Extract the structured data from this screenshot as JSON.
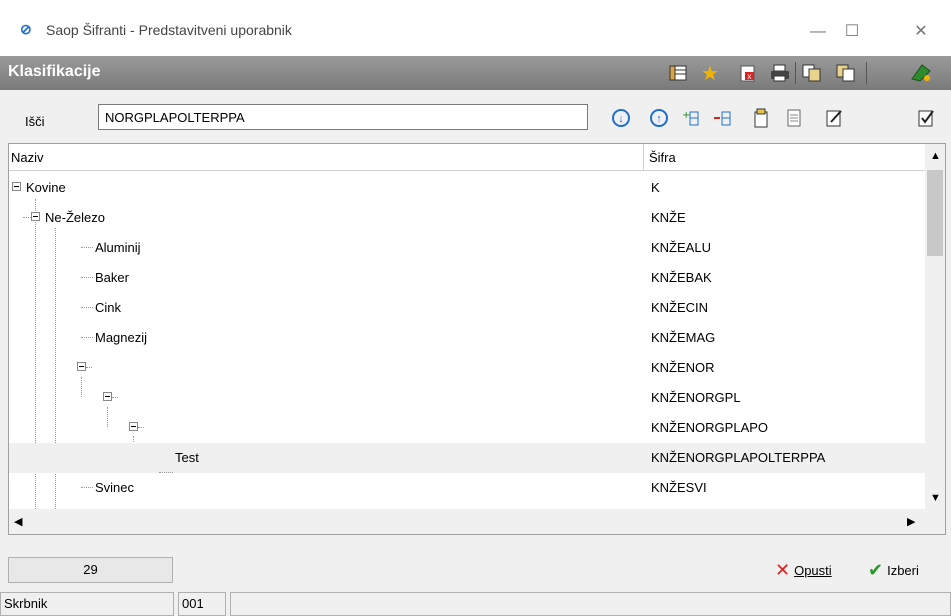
{
  "window": {
    "title": "Saop Šifranti - Predstavitveni uporabnik",
    "minimize_glyph": "—",
    "maximize_glyph": "☐",
    "close_glyph": "✕"
  },
  "header": {
    "title": "Klasifikacije",
    "toolbar_icons": [
      "columns-icon",
      "star-icon",
      "delete-icon",
      "print-icon",
      "copy-icon",
      "paste-icon",
      "exit-icon"
    ]
  },
  "search": {
    "label": "Išči",
    "value": "NORGPLAPOLTERPPA",
    "actions": [
      "arrow-down-icon",
      "arrow-up-icon",
      "add-child-icon",
      "remove-icon",
      "new-icon",
      "document-icon",
      "edit-icon",
      "edit-check-icon"
    ]
  },
  "tree": {
    "columns": {
      "name": "Naziv",
      "code": "Šifra"
    },
    "rows": [
      {
        "name": "Kovine",
        "code": "K"
      },
      {
        "name": "Ne-Železo",
        "code": "KNŽE"
      },
      {
        "name": "Aluminij",
        "code": "KNŽEALU"
      },
      {
        "name": "Baker",
        "code": "KNŽEBAK"
      },
      {
        "name": "Cink",
        "code": "KNŽECIN"
      },
      {
        "name": "Magnezij",
        "code": "KNŽEMAG"
      },
      {
        "name": "",
        "code": "KNŽENOR"
      },
      {
        "name": "",
        "code": "KNŽENORGPL"
      },
      {
        "name": "",
        "code": "KNŽENORGPLAPO"
      },
      {
        "name": "Test",
        "code": "KNŽENORGPLAPOLTERPPA"
      },
      {
        "name": "Svinec",
        "code": "KNŽESVI"
      }
    ]
  },
  "footer": {
    "count": "29",
    "cancel_label": "Opusti",
    "select_label": "Izberi"
  },
  "status": {
    "user": "Skrbnik",
    "code": "001"
  }
}
